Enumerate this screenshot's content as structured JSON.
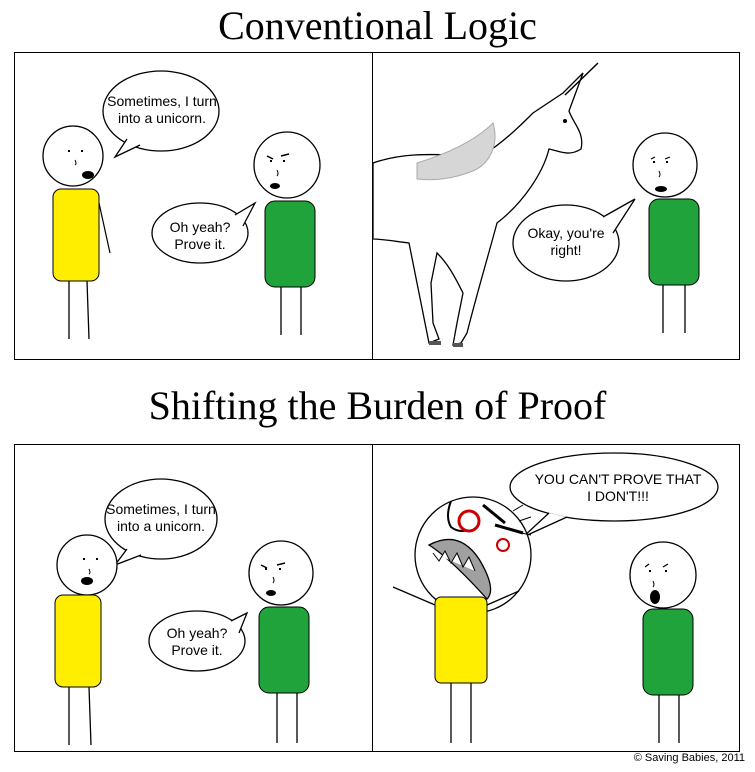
{
  "titles": {
    "top": "Conventional Logic",
    "bottom": "Shifting the Burden of Proof"
  },
  "panels": {
    "p1": {
      "speech_yellow": "Sometimes, I turn into a unicorn.",
      "speech_green": "Oh yeah? Prove it."
    },
    "p2": {
      "speech_green": "Okay, you're right!"
    },
    "p3": {
      "speech_yellow": "Sometimes, I turn into a unicorn.",
      "speech_green": "Oh yeah? Prove it."
    },
    "p4": {
      "speech_yellow": "YOU CAN'T PROVE THAT I DON'T!!!"
    }
  },
  "colors": {
    "yellow_shirt": "#ffee00",
    "green_shirt": "#1fa33a"
  },
  "credit": "© Saving Babies, 2011"
}
